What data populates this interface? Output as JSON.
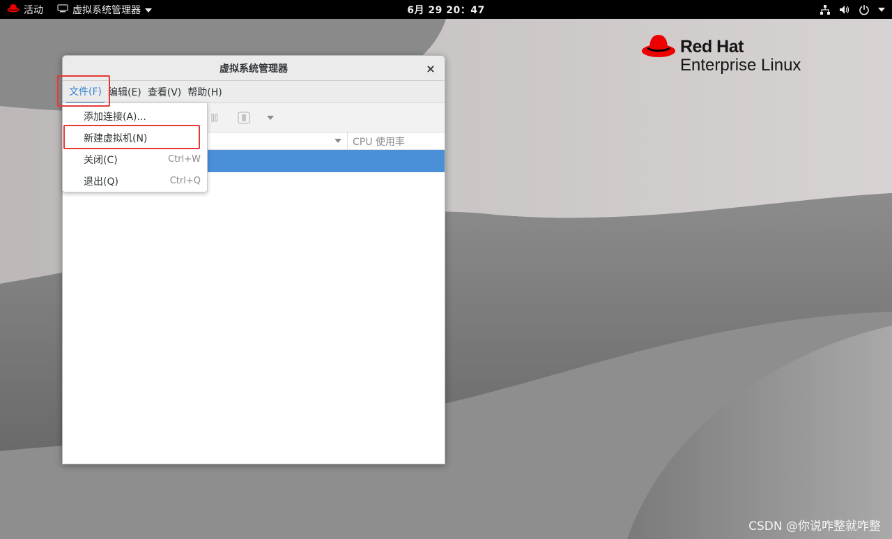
{
  "topbar": {
    "activities_label": "活动",
    "app_menu_label": "虚拟系统管理器",
    "clock": "6月 29  20：47"
  },
  "branding": {
    "line1": "Red Hat",
    "line2": "Enterprise Linux"
  },
  "window": {
    "title": "虚拟系统管理器",
    "close_label": "×",
    "menubar": [
      {
        "label": "文件(F)"
      },
      {
        "label": "编辑(E)"
      },
      {
        "label": "查看(V)"
      },
      {
        "label": "帮助(H)"
      }
    ],
    "columns": {
      "cpu_usage": "CPU 使用率"
    }
  },
  "file_menu": {
    "items": [
      {
        "label": "添加连接(A)...",
        "accel": ""
      },
      {
        "label": "新建虚拟机(N)",
        "accel": ""
      },
      {
        "label": "关闭(C)",
        "accel": "Ctrl+W"
      },
      {
        "label": "退出(Q)",
        "accel": "Ctrl+Q"
      }
    ]
  },
  "watermark": "CSDN @你说咋整就咋整",
  "colors": {
    "accent": "#3583d4",
    "selection": "#4a90d9",
    "highlight_box": "#e53935",
    "brand_red": "#ee0000"
  }
}
